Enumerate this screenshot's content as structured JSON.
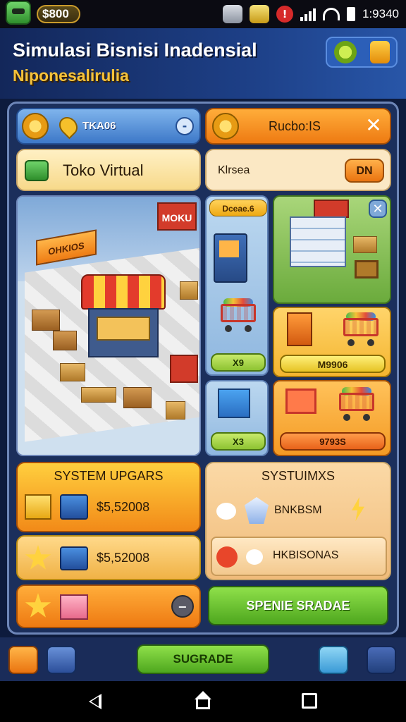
{
  "status_bar": {
    "coins": "$800",
    "time": "1:9340",
    "alert_glyph": "!"
  },
  "header": {
    "title": "Simulasi Bisnisi Inadensial",
    "subtitle": "Niponesalirulia"
  },
  "top_left_panel": {
    "label": "TKA06",
    "button_glyph": "-"
  },
  "top_right_panel": {
    "label": "Rucbo:IS",
    "close_glyph": "✕"
  },
  "store_panel": {
    "label": "Toko Virtual"
  },
  "info_panel": {
    "label": "Klrsea",
    "button": "DN"
  },
  "scene": {
    "shop_sign": "MOKU",
    "shop_banner": "OHKIOS"
  },
  "small_tile": {
    "label": "Dceae.6"
  },
  "items": [
    {
      "badge": "X9"
    },
    {
      "badge": "X3"
    }
  ],
  "right_items": [
    {
      "price": "M9906"
    },
    {
      "price": "9793S"
    }
  ],
  "system_upgrades": {
    "title": "SYSTEM UPGARS",
    "rows": [
      {
        "value": "$5,52008"
      },
      {
        "value": "$5,52008"
      }
    ],
    "minus_glyph": "−"
  },
  "systems_panel": {
    "title": "SYSTUIMXS",
    "rows": [
      {
        "label": "BNKBSM"
      },
      {
        "label": "HKBISONAS"
      }
    ]
  },
  "upgrade_button": {
    "label": "SPENIE SRADAE"
  },
  "bottom_bar": {
    "center_button": "SUGRADE"
  },
  "colors": {
    "accent_green": "#5cc23a",
    "accent_orange": "#ef7d14",
    "panel_blue": "#3d78c8"
  }
}
